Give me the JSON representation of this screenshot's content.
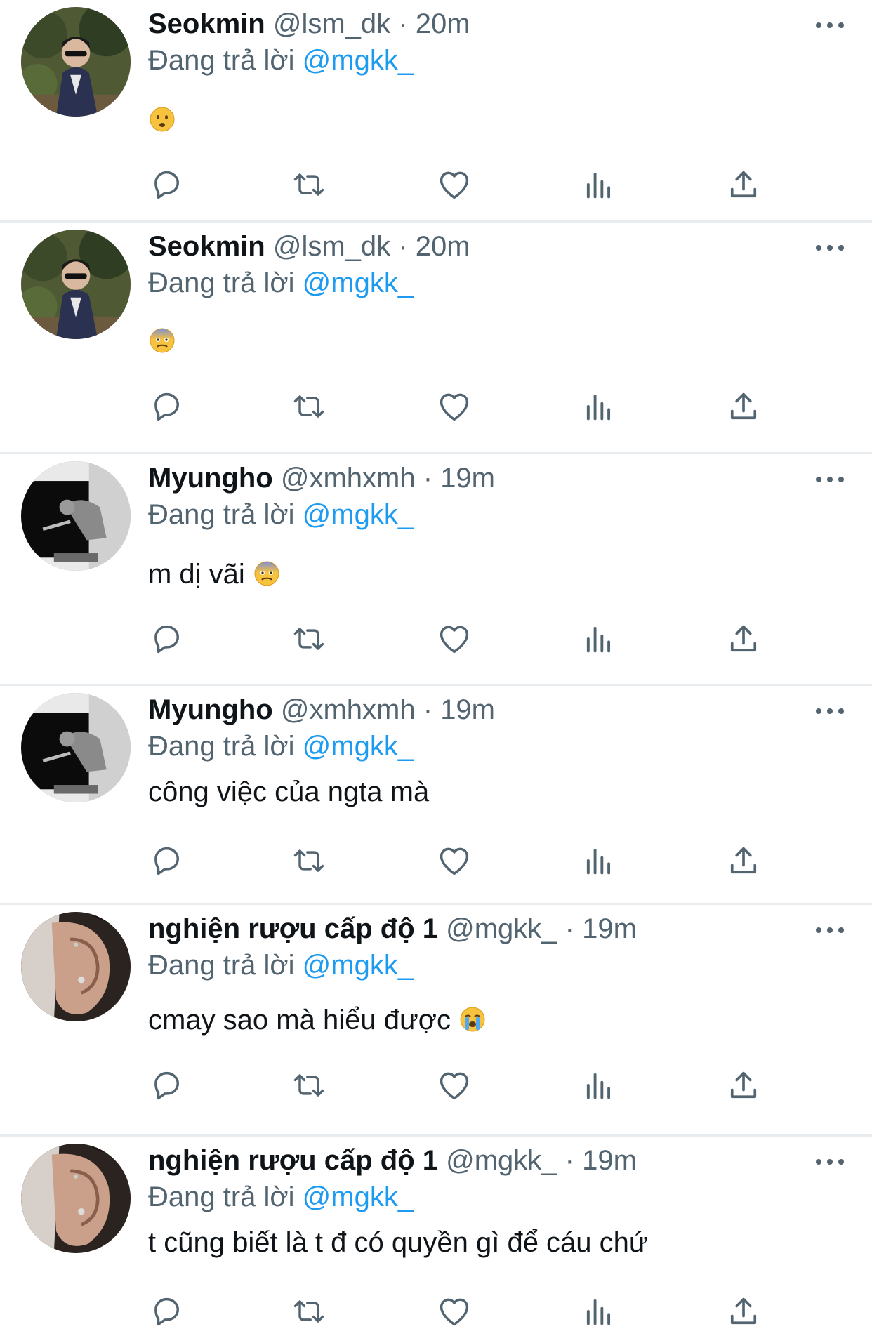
{
  "reply_prefix": "Đang trả lời",
  "colors": {
    "link": "#1d9bf0",
    "secondary": "#536471",
    "divider": "#e6ecf0"
  },
  "icons": [
    "reply-icon",
    "retweet-icon",
    "like-icon",
    "stats-icon",
    "share-icon",
    "more-icon"
  ],
  "tweets": [
    {
      "name": "Seokmin",
      "handle": "@lsm_dk",
      "sep": "·",
      "time": "20m",
      "reply_to": "@mgkk_",
      "text": "",
      "emoji": "frowning-face",
      "avatar": "seokmin"
    },
    {
      "name": "Seokmin",
      "handle": "@lsm_dk",
      "sep": "·",
      "time": "20m",
      "reply_to": "@mgkk_",
      "text": "",
      "emoji": "fearful-face",
      "avatar": "seokmin"
    },
    {
      "name": "Myungho",
      "handle": "@xmhxmh",
      "sep": "·",
      "time": "19m",
      "reply_to": "@mgkk_",
      "text": "m dị vãi",
      "emoji": "fearful-face",
      "avatar": "myungho"
    },
    {
      "name": "Myungho",
      "handle": "@xmhxmh",
      "sep": "·",
      "time": "19m",
      "reply_to": "@mgkk_",
      "text": "công việc của ngta mà",
      "emoji": "",
      "avatar": "myungho"
    },
    {
      "name": "nghiện rượu cấp độ 1",
      "handle": "@mgkk_",
      "sep": "·",
      "time": "19m",
      "reply_to": "@mgkk_",
      "text": "cmay sao mà hiểu được",
      "emoji": "crying-face",
      "avatar": "ear"
    },
    {
      "name": "nghiện rượu cấp độ 1",
      "handle": "@mgkk_",
      "sep": "·",
      "time": "19m",
      "reply_to": "@mgkk_",
      "text": "t cũng biết là t đ có quyền gì để cáu chứ",
      "emoji": "",
      "avatar": "ear"
    }
  ]
}
